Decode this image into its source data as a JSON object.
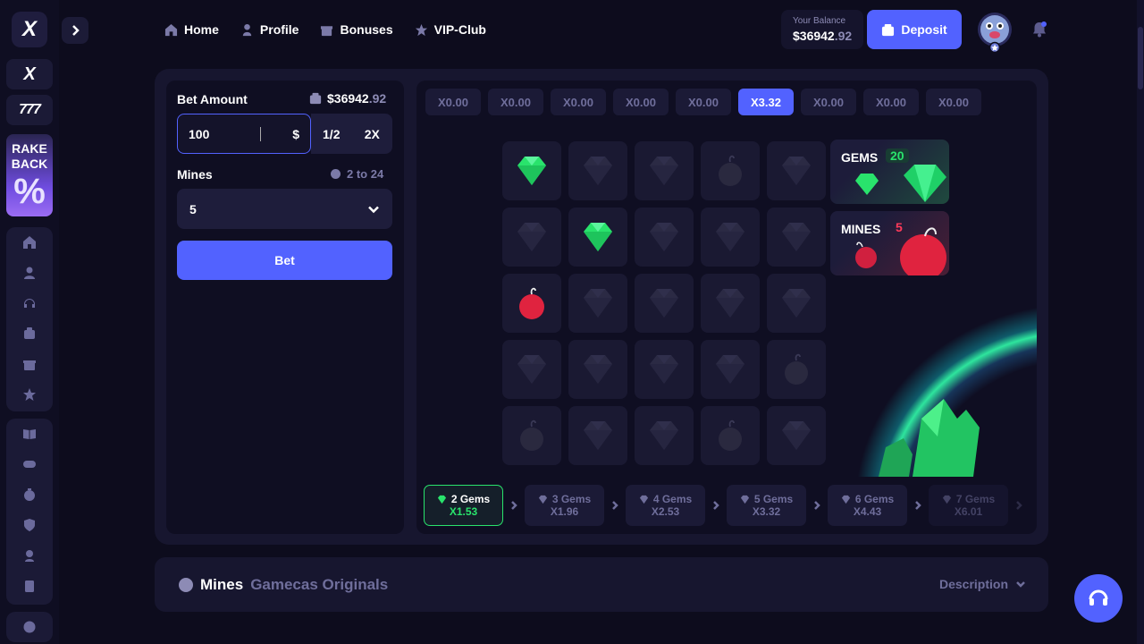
{
  "nav": {
    "home": "Home",
    "profile": "Profile",
    "bonuses": "Bonuses",
    "vip": "VIP-Club"
  },
  "sidebar": {
    "rake_line1": "RAKE",
    "rake_line2": "BACK"
  },
  "balance": {
    "label": "Your Balance",
    "amount": "$36942",
    "cents": ".92"
  },
  "deposit_label": "Deposit",
  "bet": {
    "label": "Bet Amount",
    "balance_amount": "$36942",
    "balance_cents": ".92",
    "value": "100",
    "currency": "$",
    "half": "1/2",
    "double": "2X",
    "mines_label": "Mines",
    "mines_range": "2 to 24",
    "mines_value": "5",
    "button": "Bet"
  },
  "multipliers": [
    "X0.00",
    "X0.00",
    "X0.00",
    "X0.00",
    "X0.00",
    "X3.32",
    "X0.00",
    "X0.00",
    "X0.00"
  ],
  "active_multiplier_index": 5,
  "grid": [
    [
      "gem",
      "dim-gem",
      "dim-gem",
      "dim-bomb",
      "dim-gem"
    ],
    [
      "dim-gem",
      "gem",
      "dim-gem",
      "dim-gem",
      "dim-gem"
    ],
    [
      "bomb",
      "dim-gem",
      "dim-gem",
      "dim-gem",
      "dim-gem"
    ],
    [
      "dim-gem",
      "dim-gem",
      "dim-gem",
      "dim-gem",
      "dim-bomb"
    ],
    [
      "dim-bomb",
      "dim-gem",
      "dim-gem",
      "dim-bomb",
      "dim-gem"
    ]
  ],
  "stats": {
    "gems_label": "GEMS",
    "gems_count": "20",
    "mines_label": "MINES",
    "mines_count": "5"
  },
  "steps": [
    {
      "gems": "2 Gems",
      "mult": "X1.53"
    },
    {
      "gems": "3 Gems",
      "mult": "X1.96"
    },
    {
      "gems": "4 Gems",
      "mult": "X2.53"
    },
    {
      "gems": "5 Gems",
      "mult": "X3.32"
    },
    {
      "gems": "6 Gems",
      "mult": "X4.43"
    },
    {
      "gems": "7 Gems",
      "mult": "X6.01"
    }
  ],
  "info": {
    "title": "Mines",
    "subtitle": "Gamecas Originals",
    "description": "Description"
  },
  "colors": {
    "accent": "#5262ff",
    "gem": "#29e36c",
    "mine": "#ff3a5a",
    "background": "#0d0c1d"
  }
}
